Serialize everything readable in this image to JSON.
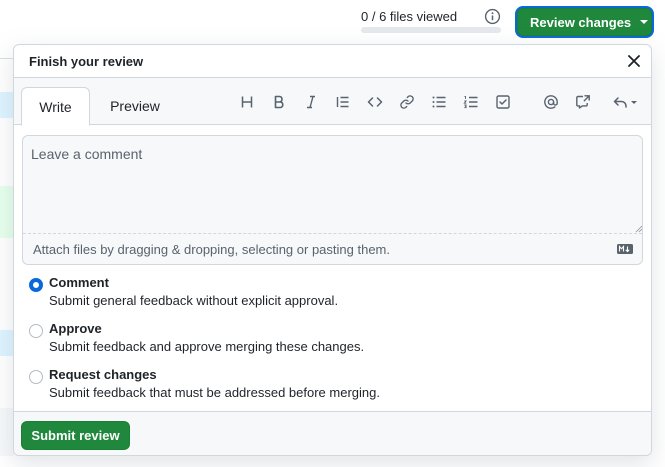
{
  "header": {
    "files_viewed_text": "0 / 6 files viewed",
    "files_viewed_progress": 0,
    "review_button_label": "Review changes"
  },
  "panel": {
    "title": "Finish your review",
    "tabs": [
      {
        "label": "Write",
        "active": true
      },
      {
        "label": "Preview",
        "active": false
      }
    ],
    "toolbar_icons": [
      "heading-icon",
      "bold-icon",
      "italic-icon",
      "quote-icon",
      "code-icon",
      "link-icon",
      "unordered-list-icon",
      "ordered-list-icon",
      "task-list-icon",
      "mention-icon",
      "cross-reference-icon",
      "undo-icon"
    ],
    "comment_placeholder": "Leave a comment",
    "comment_value": "",
    "attach_hint": "Attach files by dragging & dropping, selecting or pasting them.",
    "options": [
      {
        "title": "Comment",
        "description": "Submit general feedback without explicit approval.",
        "selected": true
      },
      {
        "title": "Approve",
        "description": "Submit feedback and approve merging these changes.",
        "selected": false
      },
      {
        "title": "Request changes",
        "description": "Submit feedback that must be addressed before merging.",
        "selected": false
      }
    ],
    "submit_label": "Submit review"
  },
  "colors": {
    "primary_green": "#1f883d",
    "focus_blue": "#0969da",
    "border": "#d0d7de",
    "muted_bg": "#f6f8fa"
  }
}
